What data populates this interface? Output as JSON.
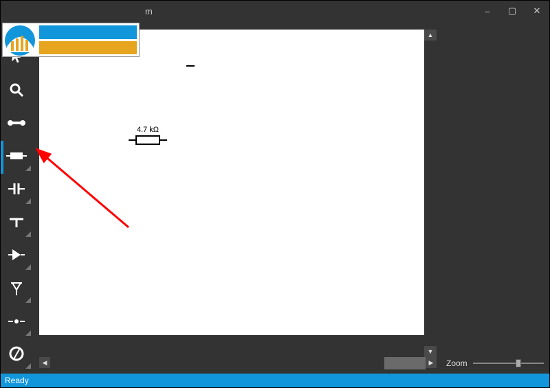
{
  "window": {
    "title_fragment": "m",
    "minimize": "–",
    "maximize": "▢",
    "close": "✕"
  },
  "toolbar": {
    "items": [
      {
        "name": "cursor-tool",
        "glyph": "cursor",
        "flyout": false
      },
      {
        "name": "zoom-tool",
        "glyph": "magnifier",
        "flyout": false
      },
      {
        "name": "wire-tool",
        "glyph": "dumbbell",
        "flyout": false
      },
      {
        "name": "resistor-tool",
        "glyph": "resistor",
        "flyout": true,
        "selected": true
      },
      {
        "name": "capacitor-tool",
        "glyph": "capacitor",
        "flyout": true
      },
      {
        "name": "ground-tool",
        "glyph": "tee",
        "flyout": true
      },
      {
        "name": "diode-tool",
        "glyph": "triangle",
        "flyout": true
      },
      {
        "name": "antenna-tool",
        "glyph": "antenna",
        "flyout": true
      },
      {
        "name": "junction-tool",
        "glyph": "hdots",
        "flyout": true
      },
      {
        "name": "circle-tool",
        "glyph": "circle",
        "flyout": true
      }
    ]
  },
  "canvas": {
    "resistor_label": "4.7 kΩ"
  },
  "right_panel": {
    "zoom_label": "Zoom",
    "zoom_value": 0.6
  },
  "statusbar": {
    "text": "Ready"
  },
  "scroll": {
    "up": "▲",
    "down": "▼",
    "left": "◀",
    "right": "▶"
  },
  "annotation": {
    "arrow_to": "resistor-tool"
  },
  "colors": {
    "accent": "#1296db",
    "arrow": "#ff0000",
    "orange": "#e7a41e"
  }
}
